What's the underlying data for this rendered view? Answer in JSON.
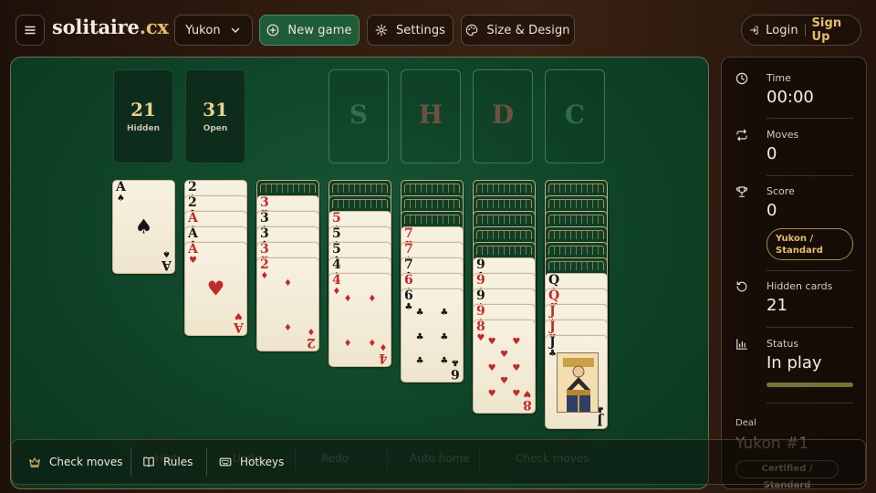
{
  "header": {
    "logo_main": "solitaire",
    "logo_tld": ".cx",
    "variant": "Yukon",
    "new_game": "New game",
    "settings": "Settings",
    "design": "Size & Design",
    "login": "Login",
    "signup": "Sign Up"
  },
  "counters": {
    "hidden_value": "21",
    "hidden_label": "Hidden",
    "open_value": "31",
    "open_label": "Open"
  },
  "foundations": [
    {
      "letter": "S",
      "color": "#2e6e49"
    },
    {
      "letter": "H",
      "color": "#6c5140"
    },
    {
      "letter": "D",
      "color": "#6c5140"
    },
    {
      "letter": "C",
      "color": "#2e6e49"
    }
  ],
  "tableau": [
    {
      "hidden": 0,
      "open": [
        {
          "rank": "A",
          "suit": "♠",
          "red": false
        }
      ]
    },
    {
      "hidden": 0,
      "open": [
        {
          "rank": "2",
          "suit": "♠",
          "red": false
        },
        {
          "rank": "2",
          "suit": "♣",
          "red": false
        },
        {
          "rank": "A",
          "suit": "♦",
          "red": true
        },
        {
          "rank": "A",
          "suit": "♣",
          "red": false
        },
        {
          "rank": "A",
          "suit": "♥",
          "red": true
        }
      ]
    },
    {
      "hidden": 1,
      "open": [
        {
          "rank": "3",
          "suit": "♥",
          "red": true
        },
        {
          "rank": "3",
          "suit": "♠",
          "red": false
        },
        {
          "rank": "3",
          "suit": "♣",
          "red": false
        },
        {
          "rank": "3",
          "suit": "♥",
          "red": true
        },
        {
          "rank": "2",
          "suit": "♦",
          "red": true
        }
      ]
    },
    {
      "hidden": 2,
      "open": [
        {
          "rank": "5",
          "suit": "♦",
          "red": true
        },
        {
          "rank": "5",
          "suit": "♠",
          "red": false
        },
        {
          "rank": "5",
          "suit": "♣",
          "red": false
        },
        {
          "rank": "4",
          "suit": "♠",
          "red": false
        },
        {
          "rank": "4",
          "suit": "♦",
          "red": true
        }
      ]
    },
    {
      "hidden": 3,
      "open": [
        {
          "rank": "7",
          "suit": "♥",
          "red": true
        },
        {
          "rank": "7",
          "suit": "♦",
          "red": true
        },
        {
          "rank": "7",
          "suit": "♣",
          "red": false
        },
        {
          "rank": "6",
          "suit": "♦",
          "red": true
        },
        {
          "rank": "6",
          "suit": "♣",
          "red": false
        }
      ]
    },
    {
      "hidden": 5,
      "open": [
        {
          "rank": "9",
          "suit": "♣",
          "red": false
        },
        {
          "rank": "9",
          "suit": "♦",
          "red": true
        },
        {
          "rank": "9",
          "suit": "♠",
          "red": false
        },
        {
          "rank": "9",
          "suit": "♦",
          "red": true
        },
        {
          "rank": "8",
          "suit": "♥",
          "red": true
        }
      ]
    },
    {
      "hidden": 6,
      "open": [
        {
          "rank": "Q",
          "suit": "♠",
          "red": false
        },
        {
          "rank": "Q",
          "suit": "♥",
          "red": true
        },
        {
          "rank": "J",
          "suit": "♦",
          "red": true
        },
        {
          "rank": "J",
          "suit": "♥",
          "red": true
        },
        {
          "rank": "J",
          "suit": "♣",
          "red": false
        }
      ]
    }
  ],
  "stats": {
    "time_label": "Time",
    "time_value": "00:00",
    "moves_label": "Moves",
    "moves_value": "0",
    "score_label": "Score",
    "score_value": "0",
    "mode_line1": "Yukon /",
    "mode_line2": "Standard",
    "hidden_label": "Hidden cards",
    "hidden_value": "21",
    "status_label": "Status",
    "status_value": "In play",
    "status_progress": 1.0
  },
  "deal": {
    "label": "Deal",
    "name": "Yukon #1",
    "badge": "Certified / Standard"
  },
  "ghost_toolbar": [
    "Hint",
    "Undo",
    "Redo",
    "Auto home",
    "Check moves"
  ],
  "bottombar": {
    "check_moves": "Check moves",
    "rules": "Rules",
    "hotkeys": "Hotkeys"
  }
}
